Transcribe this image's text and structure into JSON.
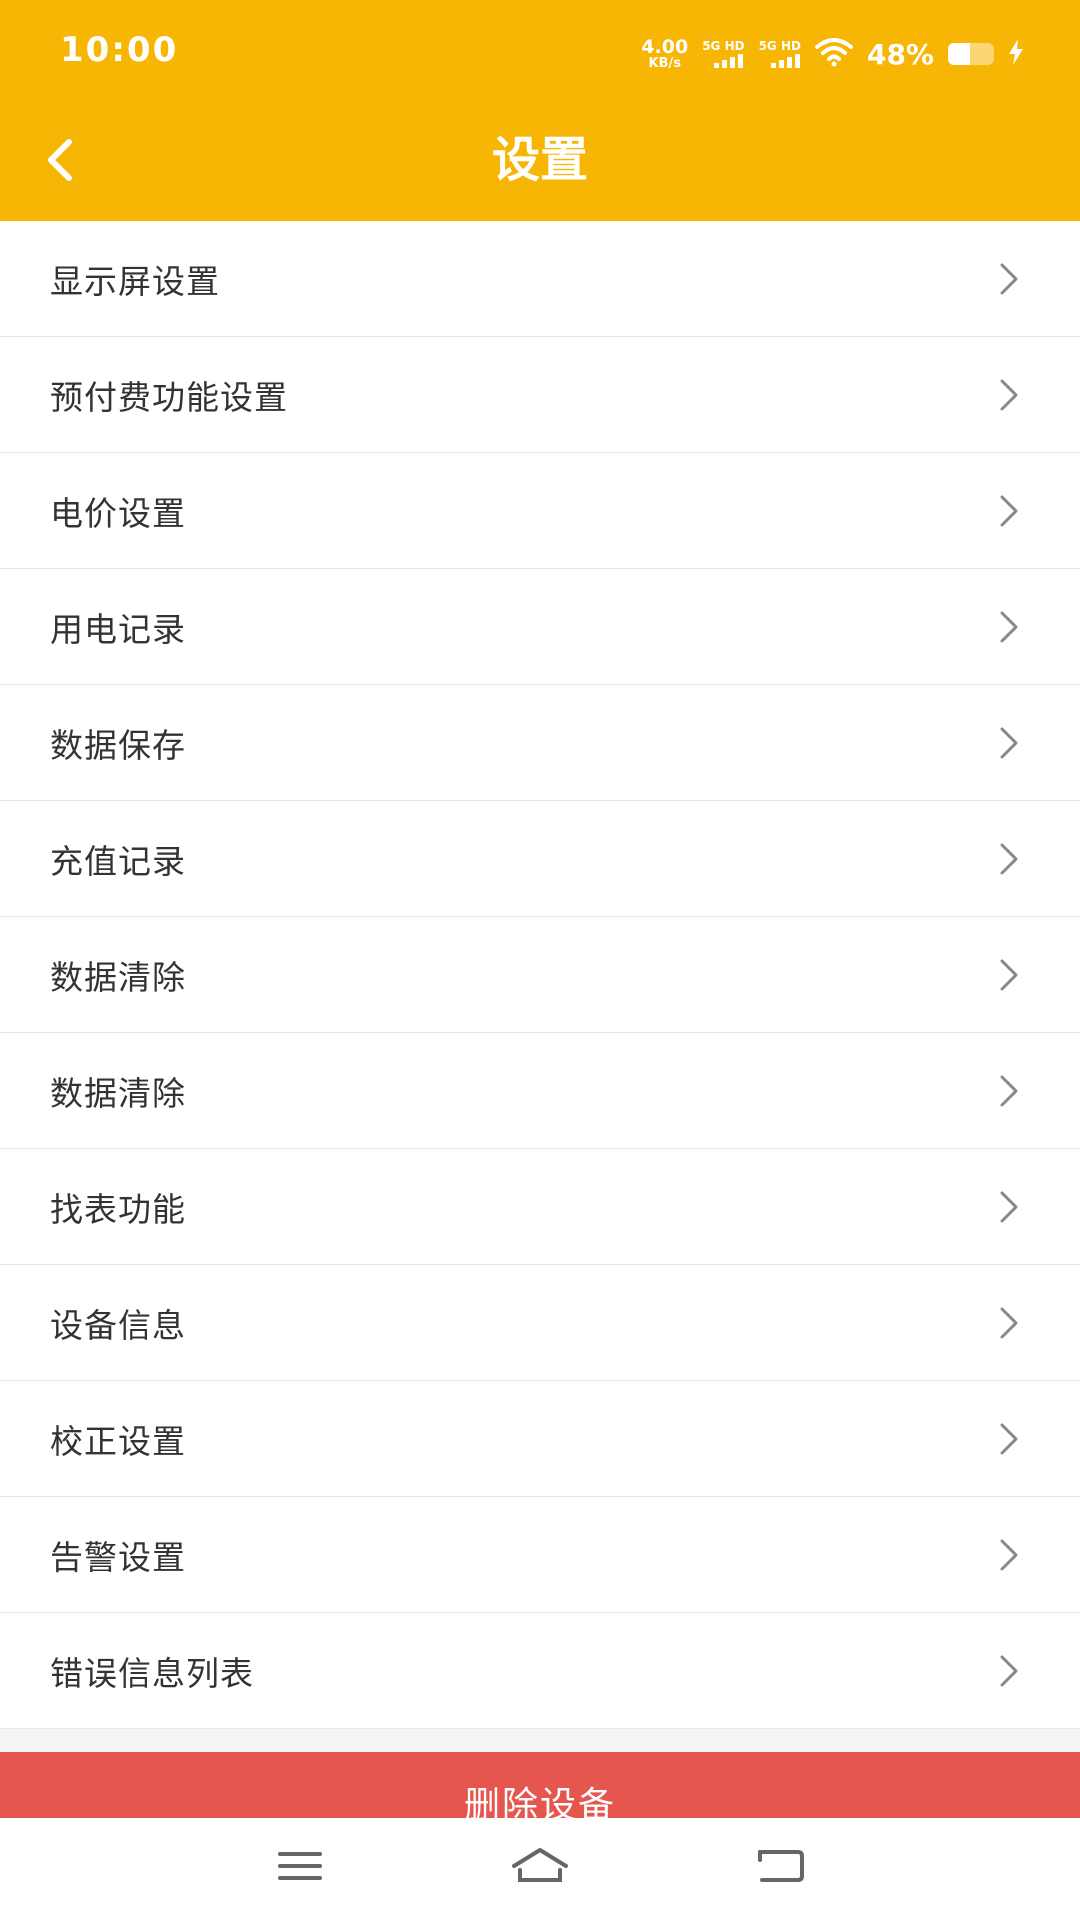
{
  "status_bar": {
    "time": "10:00",
    "net_speed_value": "4.00",
    "net_speed_unit": "KB/s",
    "sim1_label": "5G HD",
    "sim2_label": "5G HD",
    "battery_percent": "48%",
    "battery_level": 0.48
  },
  "header": {
    "title": "设置",
    "background_color": "#f7b504"
  },
  "menu": {
    "items": [
      {
        "label": "显示屏设置"
      },
      {
        "label": "预付费功能设置"
      },
      {
        "label": "电价设置"
      },
      {
        "label": "用电记录"
      },
      {
        "label": "数据保存"
      },
      {
        "label": "充值记录"
      },
      {
        "label": "数据清除"
      },
      {
        "label": "数据清除"
      },
      {
        "label": "找表功能"
      },
      {
        "label": "设备信息"
      },
      {
        "label": "校正设置"
      },
      {
        "label": "告警设置"
      },
      {
        "label": "错误信息列表"
      }
    ]
  },
  "delete_button": {
    "label": "删除设备",
    "color": "#e5574e"
  },
  "icons": {
    "back": "chevron-left-icon",
    "menu_arrow": "chevron-right-icon",
    "sys_menu": "menu-icon",
    "sys_home": "home-icon",
    "sys_back": "back-icon"
  }
}
